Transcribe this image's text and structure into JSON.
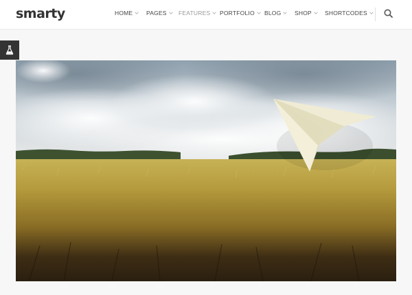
{
  "brand": {
    "logo_text": "smarty"
  },
  "nav": {
    "items": [
      {
        "label": "HOME",
        "has_dropdown": true,
        "active": false
      },
      {
        "label": "PAGES",
        "has_dropdown": true,
        "active": false
      },
      {
        "label": "FEATURES",
        "has_dropdown": true,
        "active": true
      },
      {
        "label": "PORTFOLIO",
        "has_dropdown": true,
        "active": false
      },
      {
        "label": "BLOG",
        "has_dropdown": true,
        "active": false
      },
      {
        "label": "SHOP",
        "has_dropdown": true,
        "active": false
      },
      {
        "label": "SHORTCODES",
        "has_dropdown": true,
        "active": false
      }
    ]
  },
  "icons": {
    "search": "search-icon",
    "side_tab": "flask-icon"
  },
  "hero": {
    "image": "wheat field under cloudy sky with paper airplane"
  },
  "colors": {
    "header_bg": "#ffffff",
    "page_bg": "#f7f7f7",
    "side_tab_bg": "#333333",
    "nav_active": "#999999"
  }
}
